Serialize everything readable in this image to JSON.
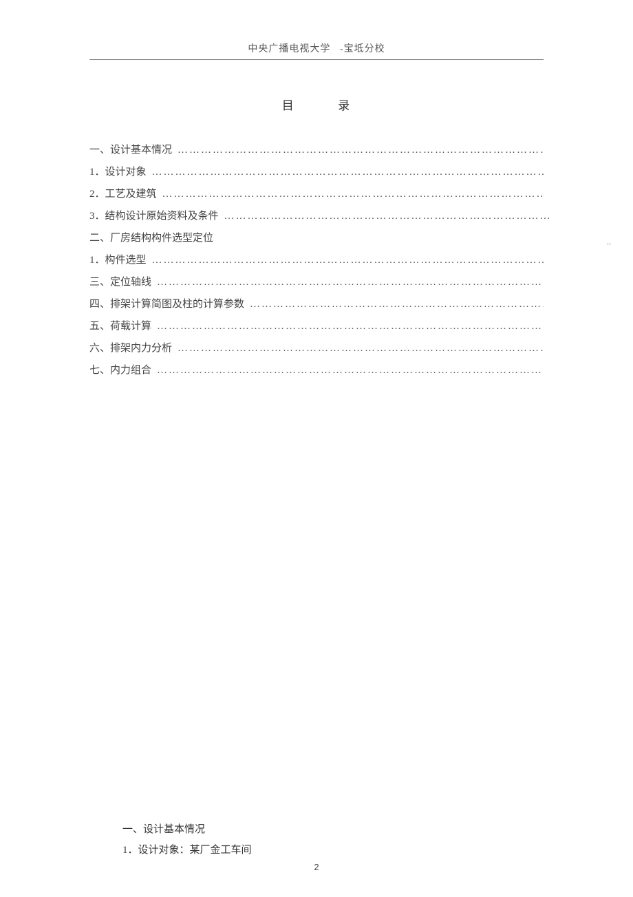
{
  "header": {
    "text": "中央广播电视大学   -宝坻分校"
  },
  "toc": {
    "title": "目          录",
    "entries": [
      {
        "label": "一、设计基本情况",
        "dots": true
      },
      {
        "label": "1．设计对象",
        "dots": true
      },
      {
        "label": "2．工艺及建筑",
        "dots": true
      },
      {
        "label": "3．结构设计原始资料及条件",
        "dots": true,
        "short": true
      },
      {
        "label": "二、厂房结构构件选型定位",
        "dots": false
      },
      {
        "label": "1．构件选型",
        "dots": true
      },
      {
        "label": "三、定位轴线",
        "dots": true
      },
      {
        "label": "四、排架计算简图及柱的计算参数",
        "dots": true
      },
      {
        "label": "五、荷载计算",
        "dots": true
      },
      {
        "label": "六、排架内力分析",
        "dots": true
      },
      {
        "label": "七、内力组合",
        "dots": true
      }
    ]
  },
  "rightMargin": {
    "dots": ".."
  },
  "content": {
    "heading": "一、设计基本情况",
    "line1": "1．设计对象：某厂金工车间"
  },
  "pageNumber": "2"
}
